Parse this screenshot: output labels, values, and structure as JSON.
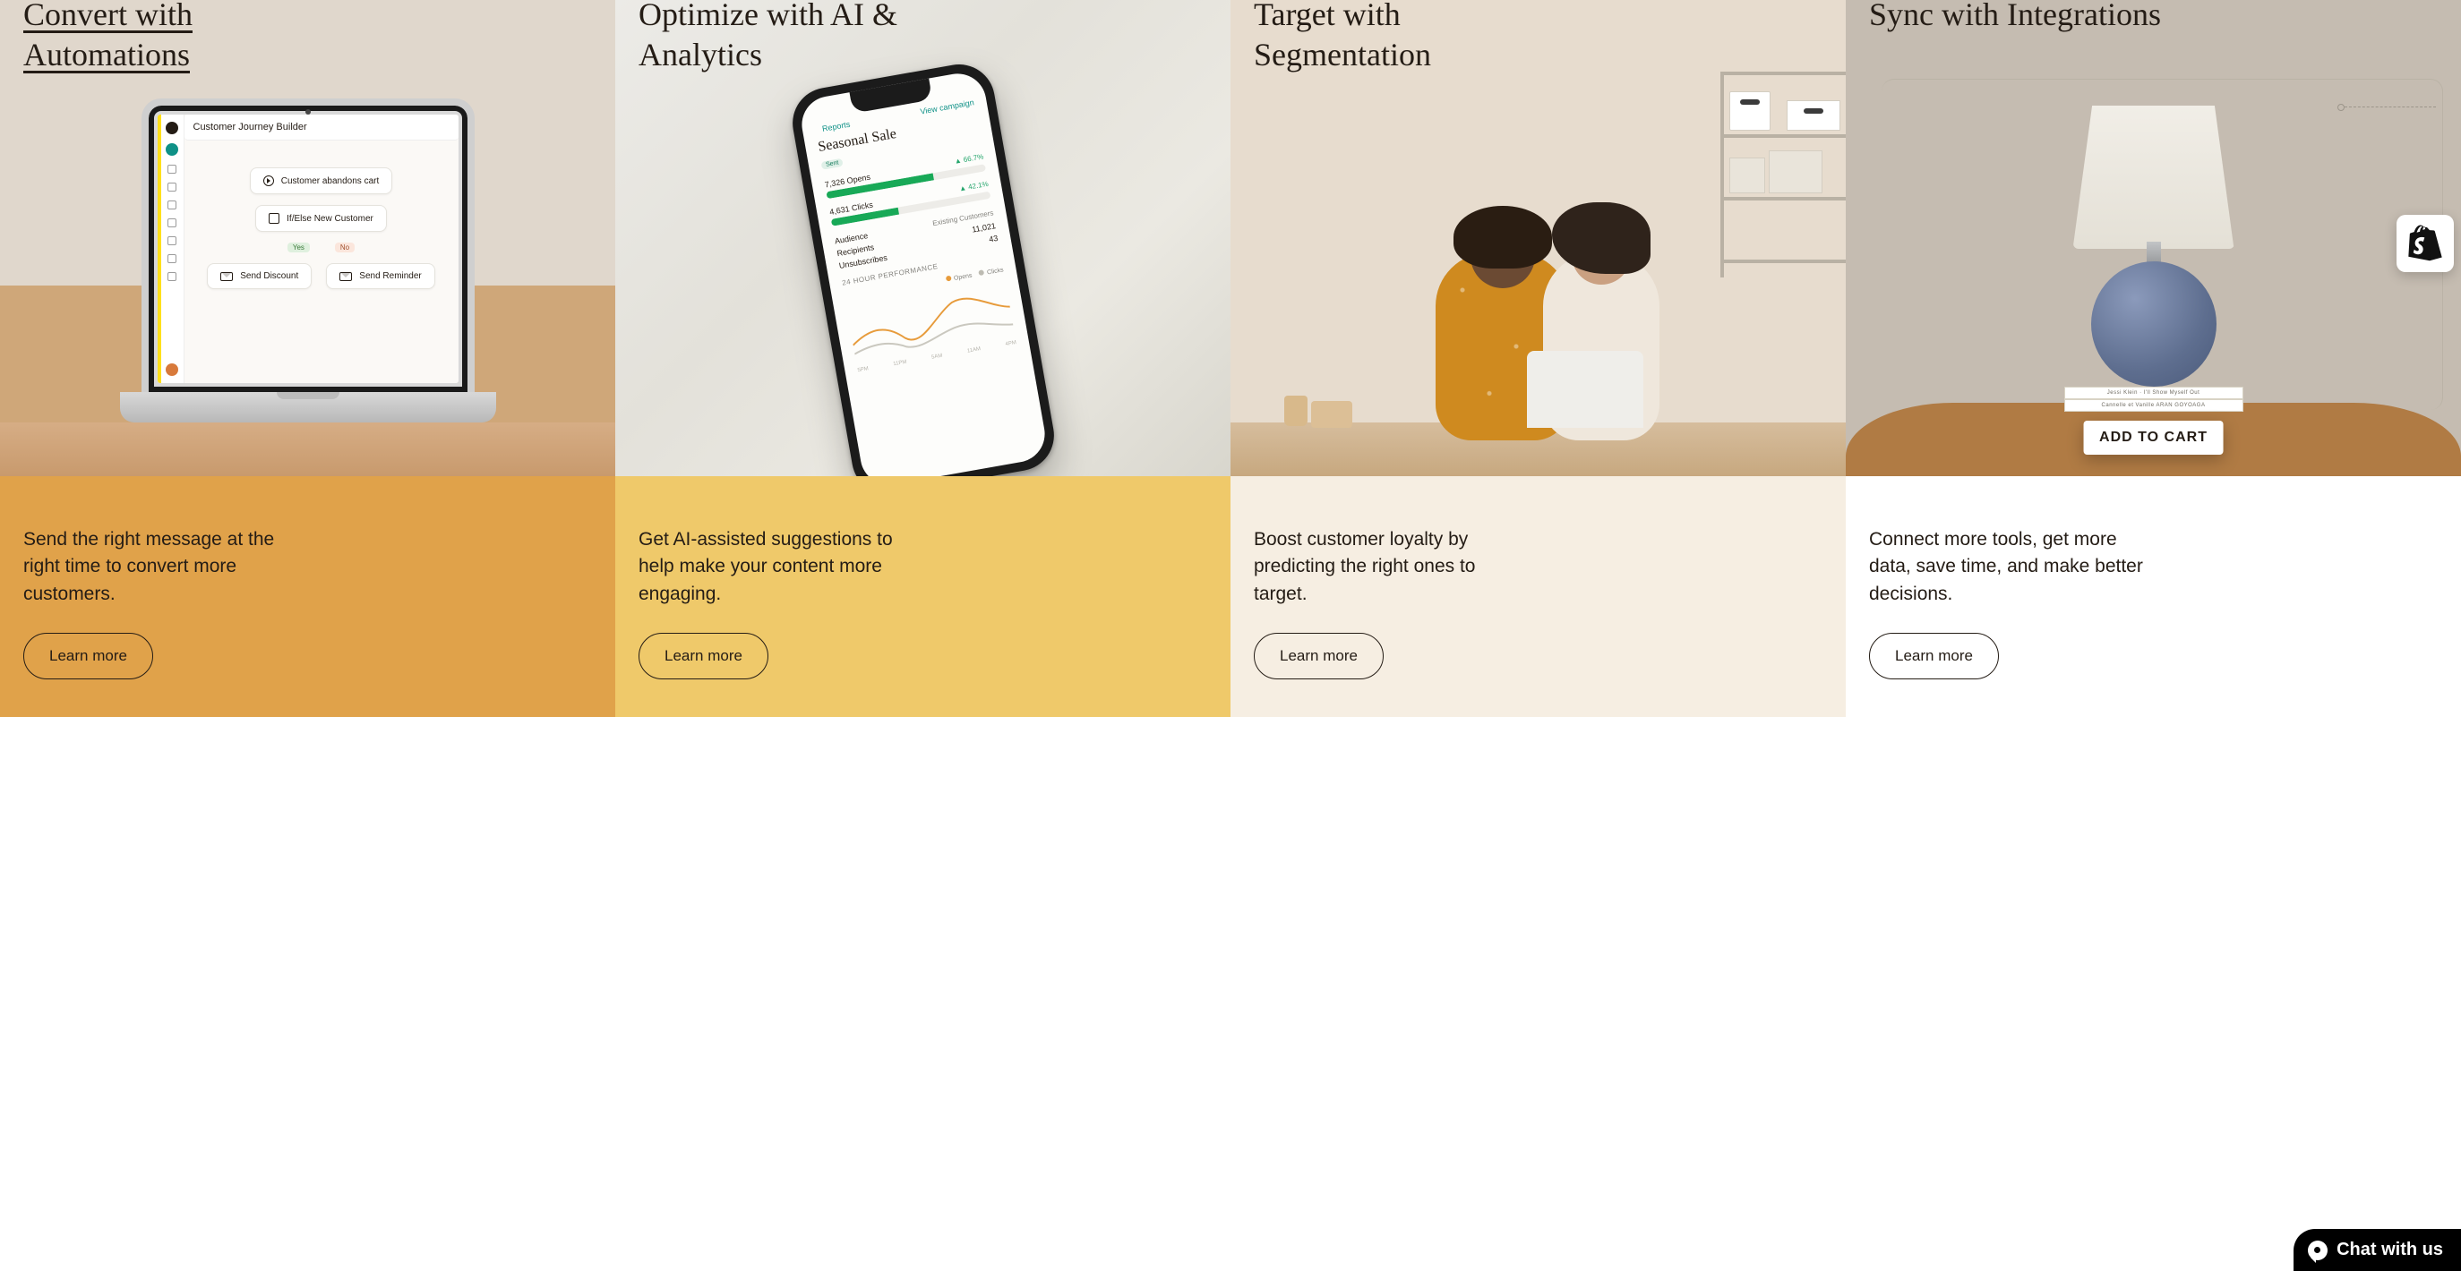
{
  "features": [
    {
      "title": "Convert with Automations",
      "description": "Send the right message at the right time to convert more customers.",
      "cta": "Learn more",
      "journey": {
        "app_title": "Customer Journey Builder",
        "node_start": "Customer abandons cart",
        "node_condition": "If/Else New Customer",
        "chip_yes": "Yes",
        "chip_no": "No",
        "node_left": "Send Discount",
        "node_right": "Send Reminder"
      }
    },
    {
      "title": "Optimize with AI & Analytics",
      "description": "Get AI-assisted suggestions to help make your content more engaging.",
      "cta": "Learn more",
      "phone": {
        "reports_link": "Reports",
        "view_link": "View campaign",
        "campaign_title": "Seasonal Sale",
        "status_badge": "Sent",
        "opens_label": "7,326 Opens",
        "opens_pct": "66.7%",
        "clicks_label": "4,631 Clicks",
        "clicks_pct": "42.1%",
        "audience_label": "Audience",
        "audience_value": "Existing Customers",
        "recipients_label": "Recipients",
        "recipients_value": "11,021",
        "unsubs_label": "Unsubscribes",
        "unsubs_value": "43",
        "perf_label": "24 HOUR PERFORMANCE",
        "legend_opens": "Opens",
        "legend_clicks": "Clicks",
        "axis": {
          "a": "5PM",
          "b": "11PM",
          "c": "5AM",
          "d": "11AM",
          "e": "4PM"
        }
      }
    },
    {
      "title": "Target with Segmentation",
      "description": "Boost customer loyalty by predicting the right ones to target.",
      "cta": "Learn more"
    },
    {
      "title": "Sync with Integrations",
      "description": "Connect more tools, get more data, save time, and make better decisions.",
      "cta": "Learn more",
      "lamp": {
        "add_to_cart": "ADD TO CART",
        "book_top": "Jessi Klein · I'll Show Myself Out",
        "book_bottom": "Cannelle et Vanille   ARAN GOYOAGA"
      }
    }
  ],
  "chart_data": {
    "type": "line",
    "title": "24 HOUR PERFORMANCE",
    "xlabel": "",
    "ylabel": "",
    "categories": [
      "5PM",
      "11PM",
      "5AM",
      "11AM",
      "4PM"
    ],
    "series": [
      {
        "name": "Opens",
        "values": [
          0.35,
          0.55,
          0.25,
          0.72,
          0.5
        ]
      },
      {
        "name": "Clicks",
        "values": [
          0.2,
          0.32,
          0.14,
          0.34,
          0.22
        ]
      }
    ],
    "ylim": [
      0,
      1
    ]
  },
  "chat": {
    "label": "Chat with us"
  }
}
